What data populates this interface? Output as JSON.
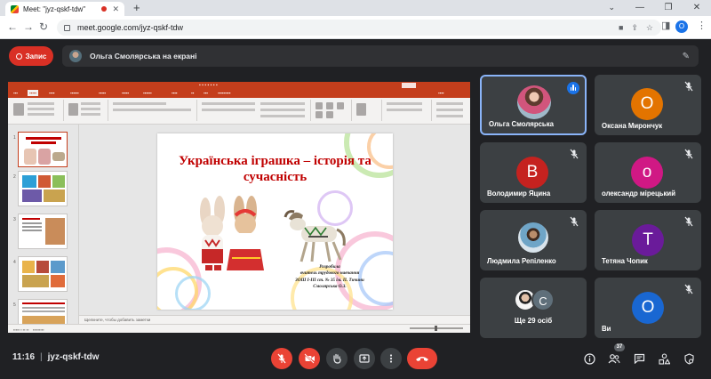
{
  "browser": {
    "tab_title": "Meet: \"jyz-qskf-tdw\"",
    "url": "meet.google.com/jyz-qskf-tdw",
    "profile_initial": "O"
  },
  "banner": {
    "record_label": "Запис",
    "presenter_text": "Ольга Смолярська на екрані"
  },
  "presentation": {
    "slide_title": "Українська іграшка – історія та сучасність",
    "credit_lines": [
      "Розробила",
      "вчитель трудового навчання",
      "ЗОШ І-ІІІ ст. № 35 ім. П. Тичини",
      "Смолярська О.З."
    ],
    "notes_placeholder": "Щелкните, чтобы добавить заметки"
  },
  "participants": [
    {
      "name": "Ольга Смолярська",
      "initial": "",
      "avatar_color": "",
      "speaking": true
    },
    {
      "name": "Оксана Мирончук",
      "initial": "O",
      "avatar_color": "#e37400",
      "speaking": false
    },
    {
      "name": "Володимир Яцина",
      "initial": "B",
      "avatar_color": "#c5221f",
      "speaking": false
    },
    {
      "name": "олександр мірецький",
      "initial": "o",
      "avatar_color": "#d01884",
      "speaking": false
    },
    {
      "name": "Людмила Репіленко",
      "initial": "",
      "avatar_color": "",
      "speaking": false
    },
    {
      "name": "Тетяна Чопик",
      "initial": "T",
      "avatar_color": "#6a1b9a",
      "speaking": false
    },
    {
      "name": "Ще 29 осіб",
      "initial": "C",
      "avatar_color": "#5f6f7a",
      "speaking": false
    },
    {
      "name": "Ви",
      "initial": "O",
      "avatar_color": "#1967d2",
      "speaking": false
    }
  ],
  "footer": {
    "time": "11:16",
    "meeting_code": "jyz-qskf-tdw",
    "participant_count": "37"
  },
  "colors": {
    "meet_bg": "#202124",
    "tile_bg": "#3c4043",
    "danger": "#ea4335",
    "speaking_outline": "#8ab4f8",
    "ppt_brand": "#c43e1c",
    "slide_title": "#c00000"
  },
  "icons": {
    "recording": "record-icon",
    "mic_off": "mic-off-icon",
    "camera_off": "camera-off-icon",
    "raise_hand": "raise-hand-icon",
    "present": "present-screen-icon",
    "more": "more-vert-icon",
    "hangup": "hangup-icon",
    "info": "info-icon",
    "people": "people-icon",
    "chat": "chat-icon",
    "activities": "activities-icon",
    "host_controls": "host-controls-icon"
  }
}
